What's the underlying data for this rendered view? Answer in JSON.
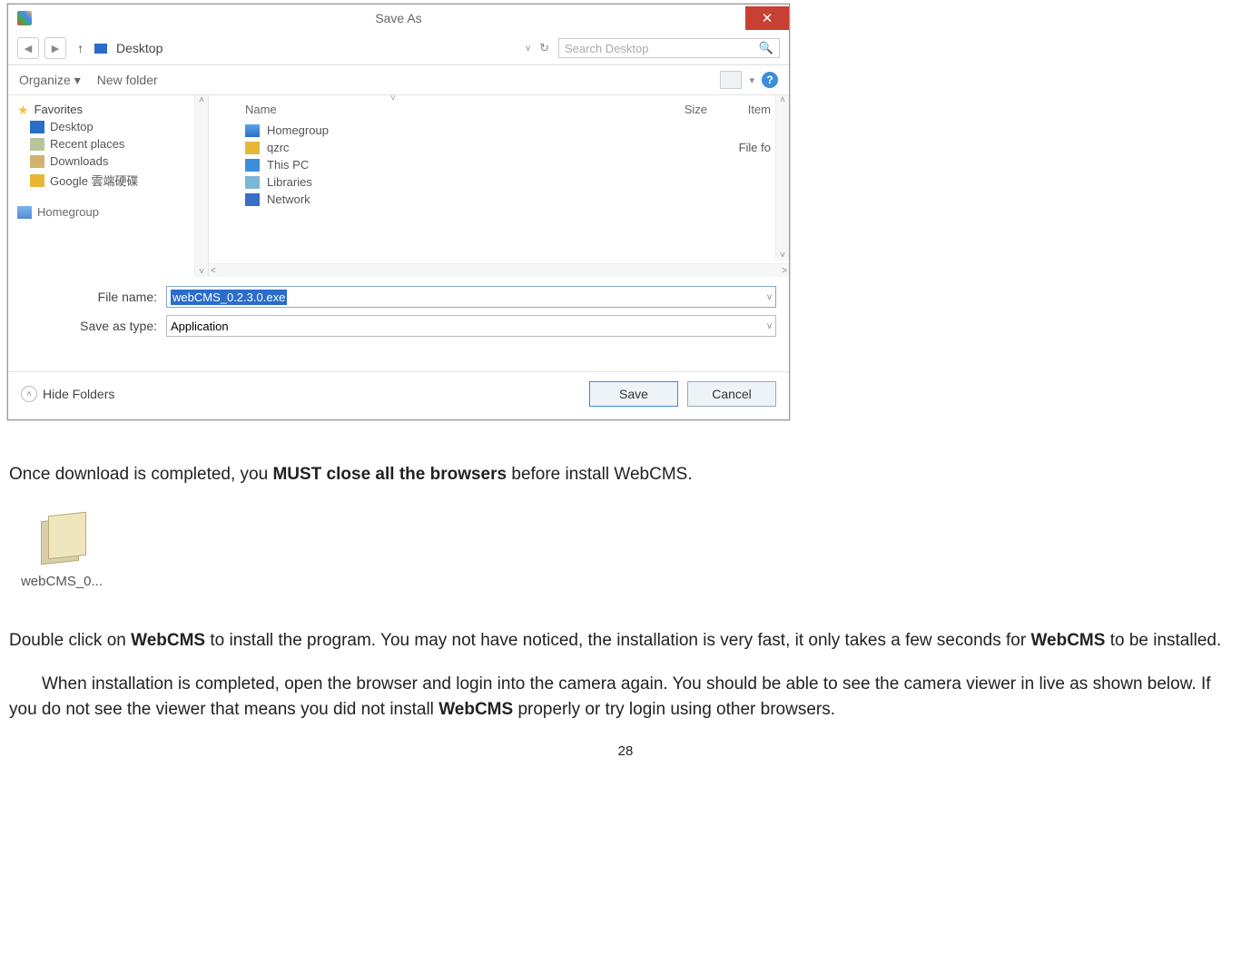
{
  "dialog": {
    "title": "Save As",
    "nav": {
      "location_label": "Desktop",
      "search_placeholder": "Search Desktop"
    },
    "toolbar": {
      "organize": "Organize ▾",
      "new_folder": "New folder"
    },
    "sidebar": {
      "favorites_label": "Favorites",
      "items": [
        {
          "label": "Desktop"
        },
        {
          "label": "Recent places"
        },
        {
          "label": "Downloads"
        },
        {
          "label": "Google 雲端硬碟"
        }
      ],
      "homegroup_cut": "Homegroup"
    },
    "columns": {
      "name": "Name",
      "size": "Size",
      "item": "Item"
    },
    "files": [
      {
        "label": "Homegroup",
        "extra": ""
      },
      {
        "label": "qzrc",
        "extra": "File fo"
      },
      {
        "label": "This PC",
        "extra": ""
      },
      {
        "label": "Libraries",
        "extra": ""
      },
      {
        "label": "Network",
        "extra": ""
      }
    ],
    "fields": {
      "filename_label": "File name:",
      "filename_value": "webCMS_0.2.3.0.exe",
      "savetype_label": "Save as type:",
      "savetype_value": "Application"
    },
    "footer": {
      "hide_folders": "Hide Folders",
      "save": "Save",
      "cancel": "Cancel"
    }
  },
  "doc": {
    "p1a": "Once download is completed, you ",
    "p1b": "MUST close all the browsers",
    "p1c": " before install WebCMS.",
    "exe_label": "webCMS_0...",
    "p2a": "Double click on ",
    "p2b": "WebCMS",
    "p2c": " to install the program. You may not have noticed, the installation is very fast, it only takes a few seconds for ",
    "p2d": "WebCMS",
    "p2e": " to be installed.",
    "p3a": "When installation is completed, open the browser and login into the camera again. You should be able to see the camera viewer in live as shown below. If you do not see the viewer that means you did not install ",
    "p3b": "WebCMS",
    "p3c": " properly or try login using other browsers.",
    "page_number": "28"
  }
}
